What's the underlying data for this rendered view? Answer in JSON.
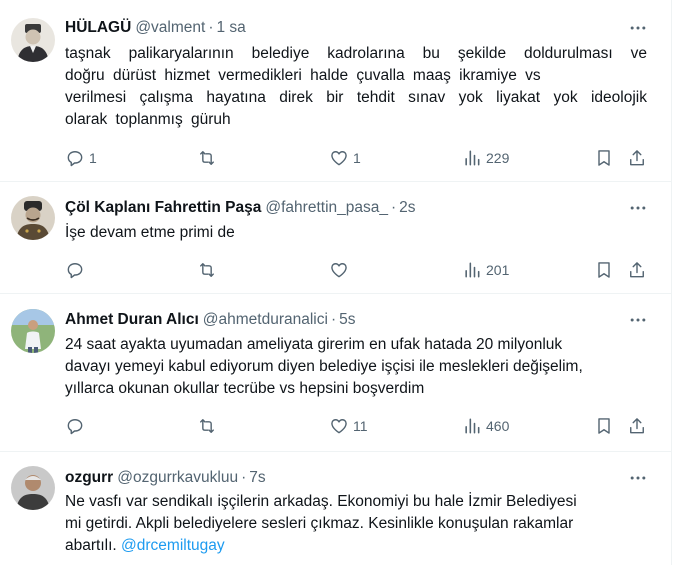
{
  "tweets": [
    {
      "name": "HÜLAGÜ",
      "handle": "@valment",
      "time": "1 sa",
      "lines": [
        "taşnak palikaryalarının belediye kadrolarına bu şekilde doldurulması ve",
        "doğru dürüst hizmet vermedikleri halde çuvalla maaş ikramiye vs",
        "verilmesi çalışma hayatına direk bir tehdit sınav yok liyakat yok ideolojik",
        "olarak toplanmış güruh"
      ],
      "replies": "1",
      "retweets": "",
      "likes": "1",
      "views": "229"
    },
    {
      "name": "Çöl Kaplanı Fahrettin Paşa",
      "handle": "@fahrettin_pasa_",
      "time": "2s",
      "lines": [
        "İşe devam etme primi de"
      ],
      "replies": "",
      "retweets": "",
      "likes": "",
      "views": "201"
    },
    {
      "name": "Ahmet Duran Alıcı",
      "handle": "@ahmetduranalici",
      "time": "5s",
      "lines": [
        "24 saat ayakta uyumadan ameliyata girerim en ufak hatada 20 milyonluk",
        "davayı yemeyi kabul ediyorum diyen belediye işçisi ile meslekleri değişelim,",
        "yıllarca okunan okullar tecrübe vs hepsini boşverdim"
      ],
      "replies": "",
      "retweets": "",
      "likes": "11",
      "views": "460"
    },
    {
      "name": "ozgurr",
      "handle": "@ozgurrkavukluu",
      "time": "7s",
      "lines": [
        "Ne vasfı var sendikalı işçilerin arkadaş. Ekonomiyi bu hale İzmir Belediyesi",
        "mi getirdi. Akpli belediyelere sesleri çıkmaz. Kesinlikle konuşulan rakamlar",
        "abartılı."
      ],
      "mention": "@drcemiltugay"
    }
  ],
  "separator": "·",
  "icons": {
    "reply": "reply-icon",
    "retweet": "retweet-icon",
    "like": "heart-icon",
    "views": "views-chart-icon",
    "bookmark": "bookmark-icon",
    "share": "share-icon",
    "more": "more-dots-icon"
  },
  "colors": {
    "text": "#0f1419",
    "secondary": "#536471",
    "link": "#1d9bf0",
    "divider": "#eff3f4"
  }
}
